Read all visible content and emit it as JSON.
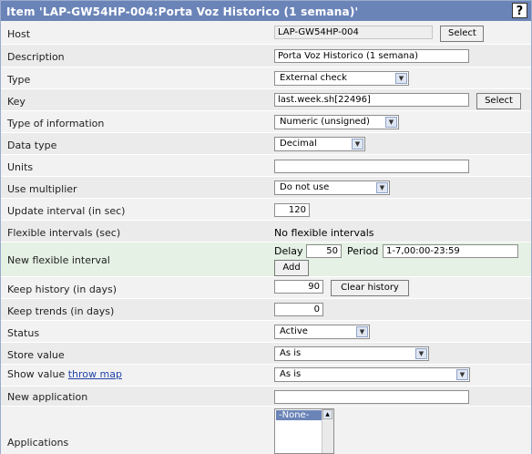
{
  "title": "Item 'LAP-GW54HP-004:Porta Voz Historico (1 semana)'",
  "help_label": "?",
  "host": {
    "label": "Host",
    "value": "LAP-GW54HP-004",
    "button": "Select"
  },
  "description": {
    "label": "Description",
    "value": "Porta Voz Historico (1 semana)"
  },
  "type": {
    "label": "Type",
    "value": "External check"
  },
  "key": {
    "label": "Key",
    "value": "last.week.sh[22496]",
    "button": "Select"
  },
  "type_of_information": {
    "label": "Type of information",
    "value": "Numeric (unsigned)"
  },
  "data_type": {
    "label": "Data type",
    "value": "Decimal"
  },
  "units": {
    "label": "Units",
    "value": ""
  },
  "use_multiplier": {
    "label": "Use multiplier",
    "value": "Do not use"
  },
  "update_interval": {
    "label": "Update interval (in sec)",
    "value": "120"
  },
  "flexible_intervals": {
    "label": "Flexible intervals (sec)",
    "value": "No flexible intervals"
  },
  "new_flexible_interval": {
    "label": "New flexible interval",
    "delay_label": "Delay",
    "delay_value": "50",
    "period_label": "Period",
    "period_value": "1-7,00:00-23:59",
    "add_button": "Add"
  },
  "keep_history": {
    "label": "Keep history (in days)",
    "value": "90",
    "button": "Clear history"
  },
  "keep_trends": {
    "label": "Keep trends (in days)",
    "value": "0"
  },
  "status": {
    "label": "Status",
    "value": "Active"
  },
  "store_value": {
    "label": "Store value",
    "value": "As is"
  },
  "show_value": {
    "label": "Show value",
    "link": "throw map",
    "value": "As is"
  },
  "new_application": {
    "label": "New application",
    "value": ""
  },
  "applications": {
    "label": "Applications",
    "options": [
      "-None-"
    ]
  }
}
